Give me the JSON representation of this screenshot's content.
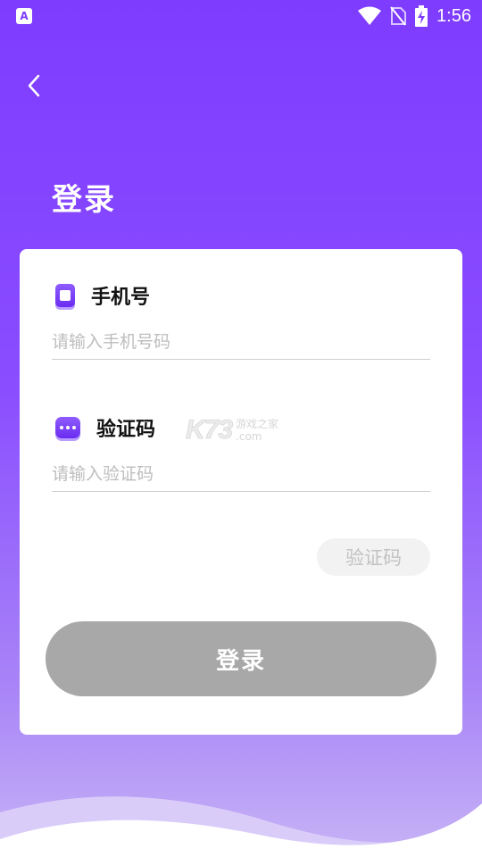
{
  "status_bar": {
    "app_icon_letter": "A",
    "time": "1:56"
  },
  "page": {
    "title": "登录"
  },
  "form": {
    "phone_label": "手机号",
    "phone_placeholder": "请输入手机号码",
    "code_label": "验证码",
    "code_placeholder": "请输入验证码",
    "get_code_button": "验证码",
    "login_button": "登录"
  },
  "watermark": {
    "main": "K73",
    "side_line1": "游戏之家",
    "side_line2": ".com"
  },
  "colors": {
    "primary": "#7e3cff",
    "login_disabled": "#a8a8a8"
  }
}
